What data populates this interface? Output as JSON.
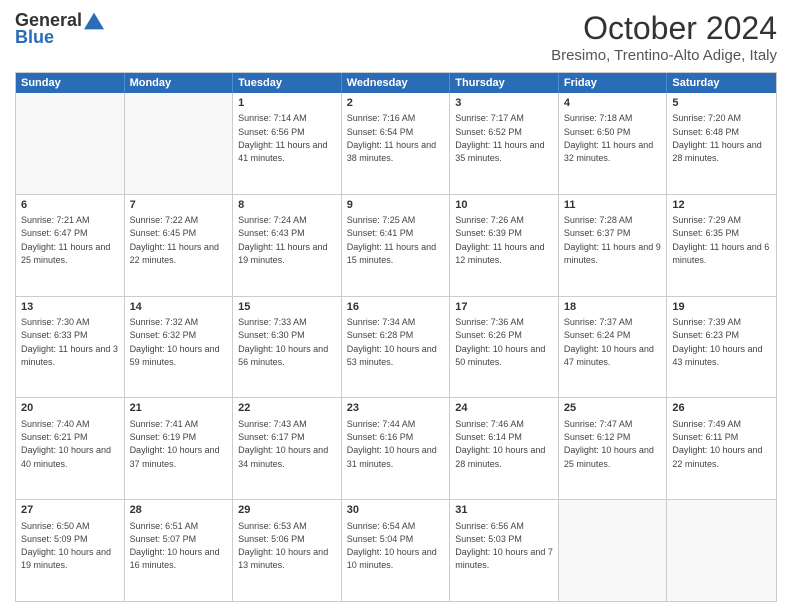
{
  "logo": {
    "general": "General",
    "blue": "Blue"
  },
  "title": "October 2024",
  "location": "Bresimo, Trentino-Alto Adige, Italy",
  "days": [
    "Sunday",
    "Monday",
    "Tuesday",
    "Wednesday",
    "Thursday",
    "Friday",
    "Saturday"
  ],
  "weeks": [
    [
      {
        "day": "",
        "sunrise": "",
        "sunset": "",
        "daylight": ""
      },
      {
        "day": "",
        "sunrise": "",
        "sunset": "",
        "daylight": ""
      },
      {
        "day": "1",
        "sunrise": "Sunrise: 7:14 AM",
        "sunset": "Sunset: 6:56 PM",
        "daylight": "Daylight: 11 hours and 41 minutes."
      },
      {
        "day": "2",
        "sunrise": "Sunrise: 7:16 AM",
        "sunset": "Sunset: 6:54 PM",
        "daylight": "Daylight: 11 hours and 38 minutes."
      },
      {
        "day": "3",
        "sunrise": "Sunrise: 7:17 AM",
        "sunset": "Sunset: 6:52 PM",
        "daylight": "Daylight: 11 hours and 35 minutes."
      },
      {
        "day": "4",
        "sunrise": "Sunrise: 7:18 AM",
        "sunset": "Sunset: 6:50 PM",
        "daylight": "Daylight: 11 hours and 32 minutes."
      },
      {
        "day": "5",
        "sunrise": "Sunrise: 7:20 AM",
        "sunset": "Sunset: 6:48 PM",
        "daylight": "Daylight: 11 hours and 28 minutes."
      }
    ],
    [
      {
        "day": "6",
        "sunrise": "Sunrise: 7:21 AM",
        "sunset": "Sunset: 6:47 PM",
        "daylight": "Daylight: 11 hours and 25 minutes."
      },
      {
        "day": "7",
        "sunrise": "Sunrise: 7:22 AM",
        "sunset": "Sunset: 6:45 PM",
        "daylight": "Daylight: 11 hours and 22 minutes."
      },
      {
        "day": "8",
        "sunrise": "Sunrise: 7:24 AM",
        "sunset": "Sunset: 6:43 PM",
        "daylight": "Daylight: 11 hours and 19 minutes."
      },
      {
        "day": "9",
        "sunrise": "Sunrise: 7:25 AM",
        "sunset": "Sunset: 6:41 PM",
        "daylight": "Daylight: 11 hours and 15 minutes."
      },
      {
        "day": "10",
        "sunrise": "Sunrise: 7:26 AM",
        "sunset": "Sunset: 6:39 PM",
        "daylight": "Daylight: 11 hours and 12 minutes."
      },
      {
        "day": "11",
        "sunrise": "Sunrise: 7:28 AM",
        "sunset": "Sunset: 6:37 PM",
        "daylight": "Daylight: 11 hours and 9 minutes."
      },
      {
        "day": "12",
        "sunrise": "Sunrise: 7:29 AM",
        "sunset": "Sunset: 6:35 PM",
        "daylight": "Daylight: 11 hours and 6 minutes."
      }
    ],
    [
      {
        "day": "13",
        "sunrise": "Sunrise: 7:30 AM",
        "sunset": "Sunset: 6:33 PM",
        "daylight": "Daylight: 11 hours and 3 minutes."
      },
      {
        "day": "14",
        "sunrise": "Sunrise: 7:32 AM",
        "sunset": "Sunset: 6:32 PM",
        "daylight": "Daylight: 10 hours and 59 minutes."
      },
      {
        "day": "15",
        "sunrise": "Sunrise: 7:33 AM",
        "sunset": "Sunset: 6:30 PM",
        "daylight": "Daylight: 10 hours and 56 minutes."
      },
      {
        "day": "16",
        "sunrise": "Sunrise: 7:34 AM",
        "sunset": "Sunset: 6:28 PM",
        "daylight": "Daylight: 10 hours and 53 minutes."
      },
      {
        "day": "17",
        "sunrise": "Sunrise: 7:36 AM",
        "sunset": "Sunset: 6:26 PM",
        "daylight": "Daylight: 10 hours and 50 minutes."
      },
      {
        "day": "18",
        "sunrise": "Sunrise: 7:37 AM",
        "sunset": "Sunset: 6:24 PM",
        "daylight": "Daylight: 10 hours and 47 minutes."
      },
      {
        "day": "19",
        "sunrise": "Sunrise: 7:39 AM",
        "sunset": "Sunset: 6:23 PM",
        "daylight": "Daylight: 10 hours and 43 minutes."
      }
    ],
    [
      {
        "day": "20",
        "sunrise": "Sunrise: 7:40 AM",
        "sunset": "Sunset: 6:21 PM",
        "daylight": "Daylight: 10 hours and 40 minutes."
      },
      {
        "day": "21",
        "sunrise": "Sunrise: 7:41 AM",
        "sunset": "Sunset: 6:19 PM",
        "daylight": "Daylight: 10 hours and 37 minutes."
      },
      {
        "day": "22",
        "sunrise": "Sunrise: 7:43 AM",
        "sunset": "Sunset: 6:17 PM",
        "daylight": "Daylight: 10 hours and 34 minutes."
      },
      {
        "day": "23",
        "sunrise": "Sunrise: 7:44 AM",
        "sunset": "Sunset: 6:16 PM",
        "daylight": "Daylight: 10 hours and 31 minutes."
      },
      {
        "day": "24",
        "sunrise": "Sunrise: 7:46 AM",
        "sunset": "Sunset: 6:14 PM",
        "daylight": "Daylight: 10 hours and 28 minutes."
      },
      {
        "day": "25",
        "sunrise": "Sunrise: 7:47 AM",
        "sunset": "Sunset: 6:12 PM",
        "daylight": "Daylight: 10 hours and 25 minutes."
      },
      {
        "day": "26",
        "sunrise": "Sunrise: 7:49 AM",
        "sunset": "Sunset: 6:11 PM",
        "daylight": "Daylight: 10 hours and 22 minutes."
      }
    ],
    [
      {
        "day": "27",
        "sunrise": "Sunrise: 6:50 AM",
        "sunset": "Sunset: 5:09 PM",
        "daylight": "Daylight: 10 hours and 19 minutes."
      },
      {
        "day": "28",
        "sunrise": "Sunrise: 6:51 AM",
        "sunset": "Sunset: 5:07 PM",
        "daylight": "Daylight: 10 hours and 16 minutes."
      },
      {
        "day": "29",
        "sunrise": "Sunrise: 6:53 AM",
        "sunset": "Sunset: 5:06 PM",
        "daylight": "Daylight: 10 hours and 13 minutes."
      },
      {
        "day": "30",
        "sunrise": "Sunrise: 6:54 AM",
        "sunset": "Sunset: 5:04 PM",
        "daylight": "Daylight: 10 hours and 10 minutes."
      },
      {
        "day": "31",
        "sunrise": "Sunrise: 6:56 AM",
        "sunset": "Sunset: 5:03 PM",
        "daylight": "Daylight: 10 hours and 7 minutes."
      },
      {
        "day": "",
        "sunrise": "",
        "sunset": "",
        "daylight": ""
      },
      {
        "day": "",
        "sunrise": "",
        "sunset": "",
        "daylight": ""
      }
    ]
  ]
}
